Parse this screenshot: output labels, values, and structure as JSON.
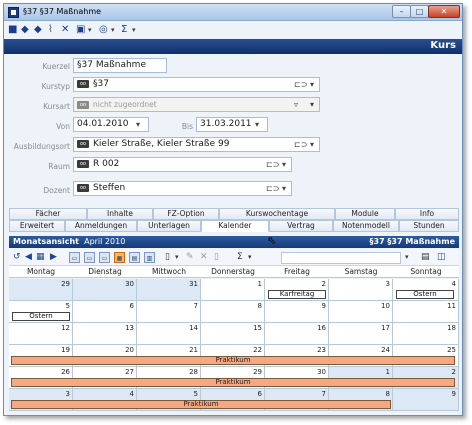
{
  "window": {
    "title": "§37 §37 Maßnahme"
  },
  "toolbar": {
    "icons": [
      "save-icon",
      "prev-icon",
      "next-icon",
      "attach-icon",
      "delete-icon",
      "word-icon",
      "info-icon",
      "sum-icon"
    ]
  },
  "header": {
    "section": "Kurs"
  },
  "form": {
    "kuerzel": {
      "label": "Kuerzel",
      "value": "§37 Maßnahme"
    },
    "kurstyp": {
      "label": "Kurstyp",
      "value": "§37"
    },
    "kursart": {
      "label": "Kursart",
      "value": "nicht zugeordnet"
    },
    "von": {
      "label": "Von",
      "value": "04.01.2010"
    },
    "bis": {
      "label": "Bis",
      "value": "31.03.2011"
    },
    "ausbildungsort": {
      "label": "Ausbildungsort",
      "value": "Kieler Straße, Kieler Straße 99"
    },
    "raum": {
      "label": "Raum",
      "value": "R 002"
    },
    "dozent": {
      "label": "Dozent",
      "value": "Steffen"
    }
  },
  "tabs_row1": [
    "Fächer",
    "Inhalte",
    "FZ-Option",
    "Kurswochentage",
    "Module",
    "Info"
  ],
  "tabs_row2": [
    "Erweitert",
    "Anmeldungen",
    "Unterlagen",
    "Kalender",
    "Vertrag",
    "Notenmodell",
    "Stunden"
  ],
  "active_tab": "Kalender",
  "calendar": {
    "view_label": "Monatsansicht",
    "month": "April 2010",
    "course": "§37 §37 Maßnahme",
    "weekdays": [
      "Montag",
      "Dienstag",
      "Mittwoch",
      "Donnerstag",
      "Freitag",
      "Samstag",
      "Sonntag"
    ],
    "weeks": [
      [
        "29",
        "30",
        "31",
        "1",
        "2",
        "3",
        "4"
      ],
      [
        "5",
        "6",
        "7",
        "8",
        "9",
        "10",
        "11"
      ],
      [
        "12",
        "13",
        "14",
        "15",
        "16",
        "17",
        "18"
      ],
      [
        "19",
        "20",
        "21",
        "22",
        "23",
        "24",
        "25"
      ],
      [
        "26",
        "27",
        "28",
        "29",
        "30",
        "1",
        "2"
      ],
      [
        "3",
        "4",
        "5",
        "6",
        "7",
        "8",
        "9"
      ]
    ],
    "events": {
      "karfreitag": "Karfreitag",
      "ostern1": "Ostern",
      "ostern2": "Ostern",
      "praktikum1": "Praktikum",
      "praktikum2": "Praktikum",
      "praktikum3": "Praktikum"
    }
  }
}
